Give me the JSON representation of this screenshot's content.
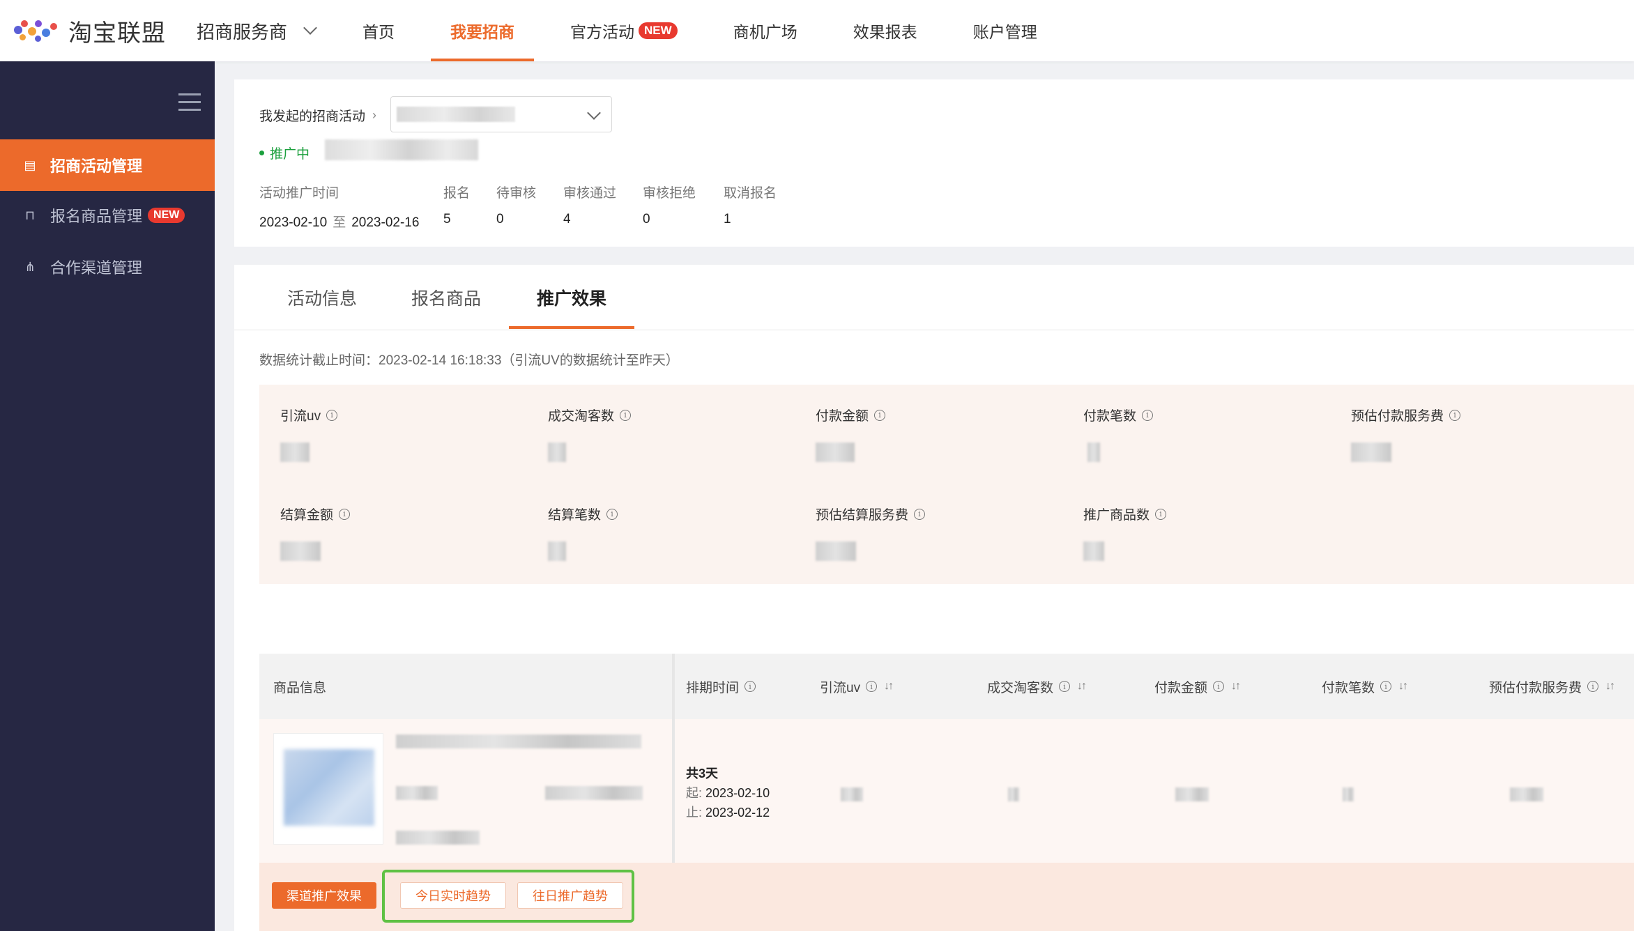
{
  "brand": {
    "name": "淘宝联盟",
    "colors": {
      "accent": "#ec6a2b",
      "sidebar": "#262743",
      "success": "#1a9f3c",
      "highlight": "#5fc144"
    }
  },
  "topbar": {
    "service": "招商服务商",
    "nav": [
      "首页",
      "我要招商",
      "官方活动",
      "商机广场",
      "效果报表",
      "账户管理"
    ],
    "new_badge": "NEW"
  },
  "sidebar": {
    "items": [
      {
        "label": "招商活动管理",
        "icon": "calendar-icon"
      },
      {
        "label": "报名商品管理",
        "icon": "bag-icon",
        "badge": "NEW"
      },
      {
        "label": "合作渠道管理",
        "icon": "org-icon"
      }
    ]
  },
  "activity": {
    "breadcrumb": "我发起的招商活动",
    "status": "推广中",
    "headers": [
      "活动推广时间",
      "报名",
      "待审核",
      "审核通过",
      "审核拒绝",
      "取消报名"
    ],
    "start": "2023-02-10",
    "to": "至",
    "end": "2023-02-16",
    "counts": [
      "5",
      "0",
      "4",
      "0",
      "1"
    ]
  },
  "tabs": [
    "活动信息",
    "报名商品",
    "推广效果"
  ],
  "stat_time": "数据统计截止时间：2023-02-14 16:18:33（引流UV的数据统计至昨天）",
  "metrics": [
    "引流uv",
    "成交淘客数",
    "付款金额",
    "付款笔数",
    "预估付款服务费",
    "结算金额",
    "结算笔数",
    "预估结算服务费",
    "推广商品数"
  ],
  "table": {
    "headers": [
      "商品信息",
      "排期时间",
      "引流uv",
      "成交淘客数",
      "付款金额",
      "付款笔数",
      "预估付款服务费"
    ],
    "row": {
      "schedule_total": "共3天",
      "start_label": "起:",
      "start": "2023-02-10",
      "end_label": "止:",
      "end": "2023-02-12"
    }
  },
  "actions": [
    "渠道推广效果",
    "今日实时趋势",
    "往日推广趋势"
  ]
}
